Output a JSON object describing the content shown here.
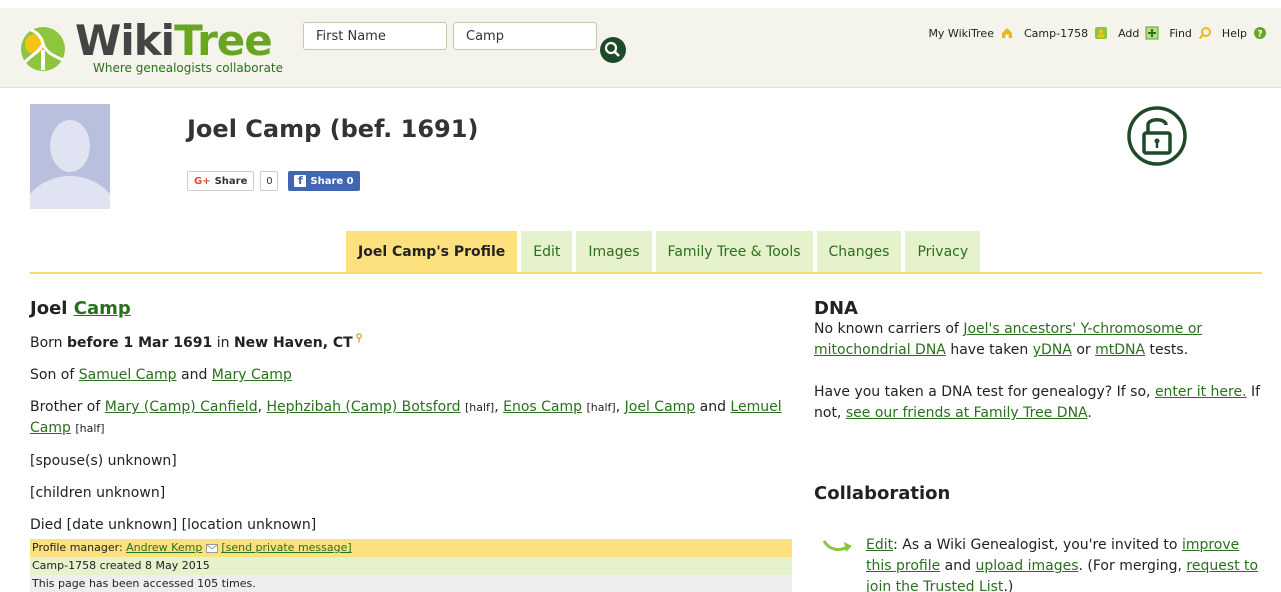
{
  "header": {
    "logo_wiki": "Wiki",
    "logo_tree": "Tree",
    "tagline": "Where genealogists collaborate",
    "search": {
      "first_name": "First Name",
      "last_name": "Camp"
    },
    "nav": [
      {
        "label": "My WikiTree",
        "icon": "home-icon"
      },
      {
        "label": "Camp-1758",
        "icon": "profile-icon"
      },
      {
        "label": "Add",
        "icon": "plus-icon"
      },
      {
        "label": "Find",
        "icon": "magnifier-icon"
      },
      {
        "label": "Help",
        "icon": "question-icon"
      }
    ]
  },
  "profile": {
    "title": "Joel Camp (bef. 1691)",
    "share": {
      "google": "Share",
      "google_prefix": "G+",
      "count": "0",
      "facebook": "Share 0"
    }
  },
  "tabs": [
    {
      "label": "Joel Camp's Profile",
      "active": true
    },
    {
      "label": "Edit"
    },
    {
      "label": "Images"
    },
    {
      "label": "Family Tree & Tools"
    },
    {
      "label": "Changes"
    },
    {
      "label": "Privacy"
    }
  ],
  "left": {
    "first_name": "Joel",
    "last_name": "Camp",
    "born_prefix": "Born",
    "born_date": "before 1 Mar 1691",
    "born_in": "in",
    "born_place": "New Haven, CT",
    "son_of_prefix": "Son of",
    "father": "Samuel Camp",
    "and": "and",
    "mother": "Mary Camp",
    "brother_of_prefix": "Brother of",
    "siblings": [
      {
        "name": "Mary (Camp) Canfield",
        "note": ""
      },
      {
        "name": "Hephzibah (Camp) Botsford",
        "note": "[half]"
      },
      {
        "name": "Enos Camp",
        "note": "[half]"
      },
      {
        "name": "Joel Camp",
        "note": ""
      },
      {
        "name": "Lemuel Camp",
        "note": "[half]"
      }
    ],
    "spouse": "[spouse(s) unknown]",
    "children": "[children unknown]",
    "died": "Died [date unknown] [location unknown]",
    "manager_label": "Profile manager:",
    "manager_name": "Andrew Kemp",
    "manager_msg": "[send private message]",
    "created": "Camp-1758 created 8 May 2015",
    "accessed": "This page has been accessed 105 times."
  },
  "right": {
    "dna_heading": "DNA",
    "dna_text1": "No known carriers of",
    "dna_link1": "Joel's ancestors' Y-chromosome or mitochondrial DNA",
    "dna_text2": "have taken",
    "dna_link_ydna": "yDNA",
    "dna_or": "or",
    "dna_link_mtdna": "mtDNA",
    "dna_text3": "tests.",
    "dna_q": "Have you taken a DNA test for genealogy? If so,",
    "dna_link_enter": "enter it here.",
    "dna_if_not": "If not,",
    "dna_link_friends": "see our friends at Family Tree DNA",
    "collab_heading": "Collaboration",
    "collab_edit": "Edit",
    "collab_text1": ": As a Wiki Genealogist, you're invited to",
    "collab_link_improve": "improve this profile",
    "collab_and": "and",
    "collab_link_upload": "upload images",
    "collab_text2": ". (For merging,",
    "collab_link_join": "request to join the Trusted List",
    "collab_text3": ".)"
  }
}
